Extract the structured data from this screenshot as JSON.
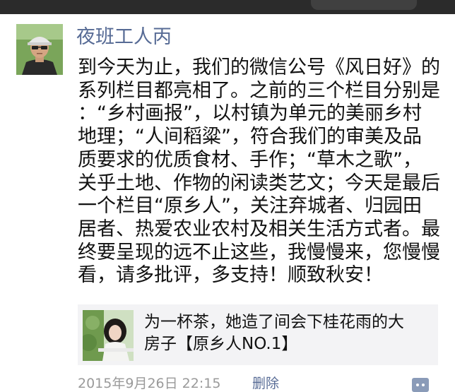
{
  "post": {
    "username": "夜班工人丙",
    "text_lines": [
      "到今天为止，我们的微信公号《风日好》的",
      "系列栏目都亮相了。之前的三个栏目分别是",
      "：“乡村画报”，以村镇为单元的美丽乡村",
      "地理；“人间稻粱”，符合我们的审美及品",
      "质要求的优质食材、手作；“草木之歌”，",
      "关乎土地、作物的闲读类艺文；今天是最后",
      "一个栏目“原乡人”，关注弃城者、归园田",
      "居者、热爱农业农村及相关生活方式者。最",
      "终要呈现的远不止这些，我慢慢来，您慢慢",
      "看，请多批评，多支持！顺致秋安！"
    ],
    "share": {
      "title_lines": [
        "为一杯茶，她造了间会下桂花雨的大",
        "房子【原乡人NO.1】"
      ]
    },
    "timestamp": "2015年9月26日 22:15",
    "delete_label": "删除"
  },
  "colors": {
    "name_link": "#576b95",
    "body_text": "#111111",
    "meta_text": "#9a9a9a",
    "card_bg": "#f3f3f5"
  },
  "icons": {
    "avatar": "user-photo-avatar",
    "share_thumb": "article-thumbnail-image",
    "comment": "comment-icon"
  }
}
